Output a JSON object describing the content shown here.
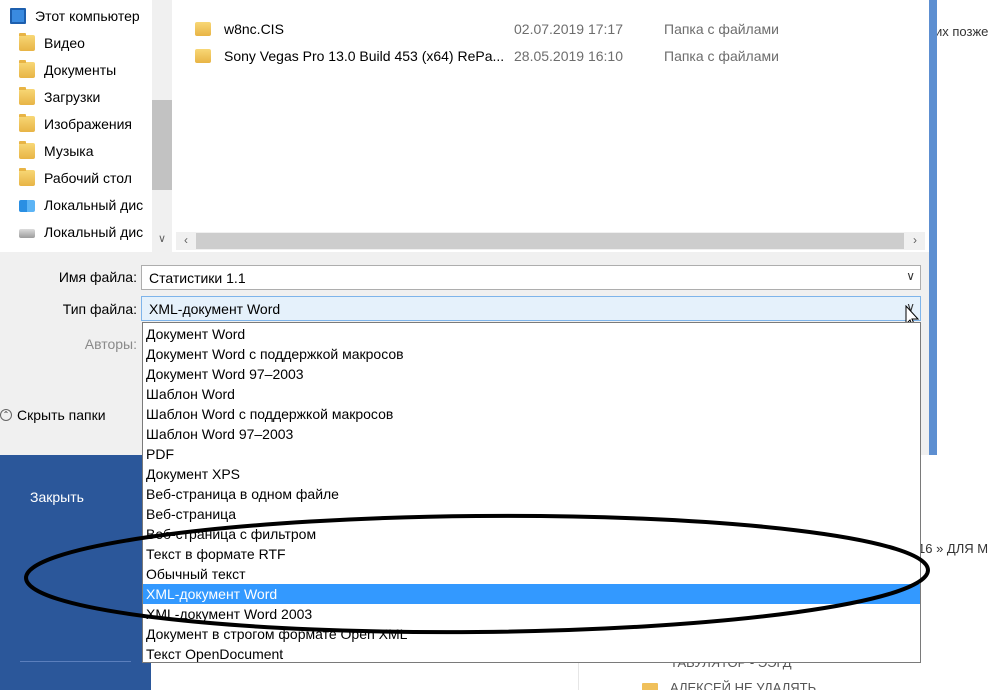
{
  "nav_pane": {
    "items": [
      {
        "label": "Этот компьютер",
        "icon": "computer-icon"
      },
      {
        "label": "Видео",
        "icon": "folder-icon"
      },
      {
        "label": "Документы",
        "icon": "folder-icon"
      },
      {
        "label": "Загрузки",
        "icon": "folder-icon"
      },
      {
        "label": "Изображения",
        "icon": "folder-icon"
      },
      {
        "label": "Музыка",
        "icon": "folder-icon"
      },
      {
        "label": "Рабочий стол",
        "icon": "folder-icon"
      },
      {
        "label": "Локальный дис",
        "icon": "windows-drive-icon"
      },
      {
        "label": "Локальный дис",
        "icon": "drive-icon"
      }
    ]
  },
  "files": [
    {
      "name": "w8nc.CIS",
      "date": "02.07.2019 17:17",
      "type": "Папка с файлами"
    },
    {
      "name": "Sony Vegas Pro 13.0 Build 453 (x64) RePa...",
      "date": "28.05.2019 16:10",
      "type": "Папка с файлами"
    }
  ],
  "fields": {
    "filename_label": "Имя файла:",
    "filename_value": "Статистики 1.1",
    "filetype_label": "Тип файла:",
    "filetype_value": "XML-документ Word",
    "authors_label": "Авторы:"
  },
  "hide_folders_label": "Скрыть папки",
  "dropdown_options": [
    "Документ Word",
    "Документ Word с поддержкой макросов",
    "Документ Word 97–2003",
    "Шаблон Word",
    "Шаблон Word с поддержкой макросов",
    "Шаблон Word 97–2003",
    "PDF",
    "Документ XPS",
    "Веб-страница в одном файле",
    "Веб-страница",
    "Веб-страница с фильтром",
    "Текст в формате RTF",
    "Обычный текст",
    "XML-документ Word",
    "XML-документ Word 2003",
    "Документ в строгом формате Open XML",
    "Текст OpenDocument"
  ],
  "selected_option": "XML-документ Word",
  "backstage": {
    "close_label": "Закрыть",
    "bg_text_top": "их позже",
    "bg_text_mid": "16 » ДЛЯ М",
    "bg_text_bottom1": "ТАБУЛЯТОР - ЭЭГД",
    "bg_text_bottom2": "АЛЕКСЕЙ НЕ УДАЛЯТЬ"
  },
  "colors": {
    "selection": "#3399ff",
    "backstage_nav": "#2b579a",
    "dialog_accent": "#5d8fd1",
    "annotation": "#000000"
  }
}
